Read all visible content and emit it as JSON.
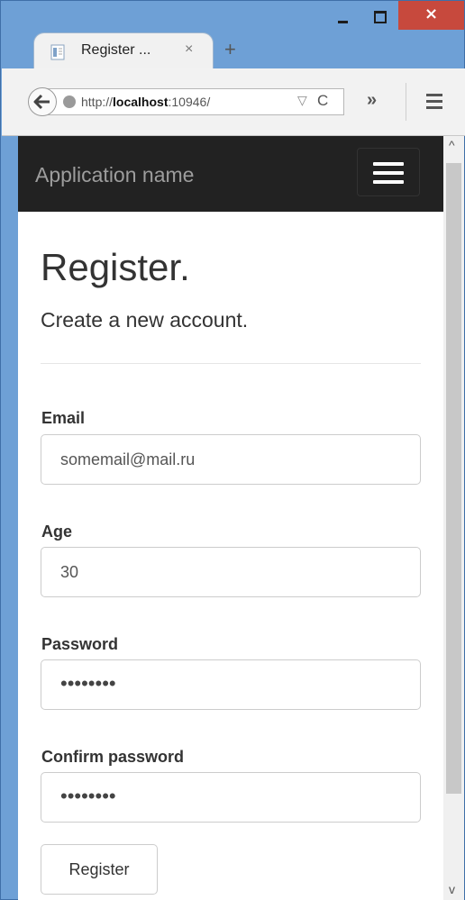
{
  "browser": {
    "tab_title": "Register ...",
    "tab_close": "×",
    "new_tab": "+",
    "url_prefix": "http://",
    "url_host": "localhost",
    "url_rest": ":10946/",
    "reload": "C",
    "overflow": "»",
    "window_close": "×"
  },
  "navbar": {
    "brand": "Application name"
  },
  "page": {
    "title": "Register.",
    "subtitle": "Create a new account."
  },
  "form": {
    "email_label": "Email",
    "email_value": "somemail@mail.ru",
    "age_label": "Age",
    "age_value": "30",
    "password_label": "Password",
    "password_value": "••••••••",
    "confirm_label": "Confirm password",
    "confirm_value": "••••••••",
    "submit_label": "Register"
  },
  "colors": {
    "navbar_bg": "#222222",
    "brand_text": "#9d9d9d",
    "window_frame": "#6ea0d6",
    "close_button": "#c7493d"
  },
  "icons": [
    "page-icon",
    "back-arrow-icon",
    "globe-icon",
    "reload-icon",
    "menu-icon",
    "hamburger-icon"
  ]
}
